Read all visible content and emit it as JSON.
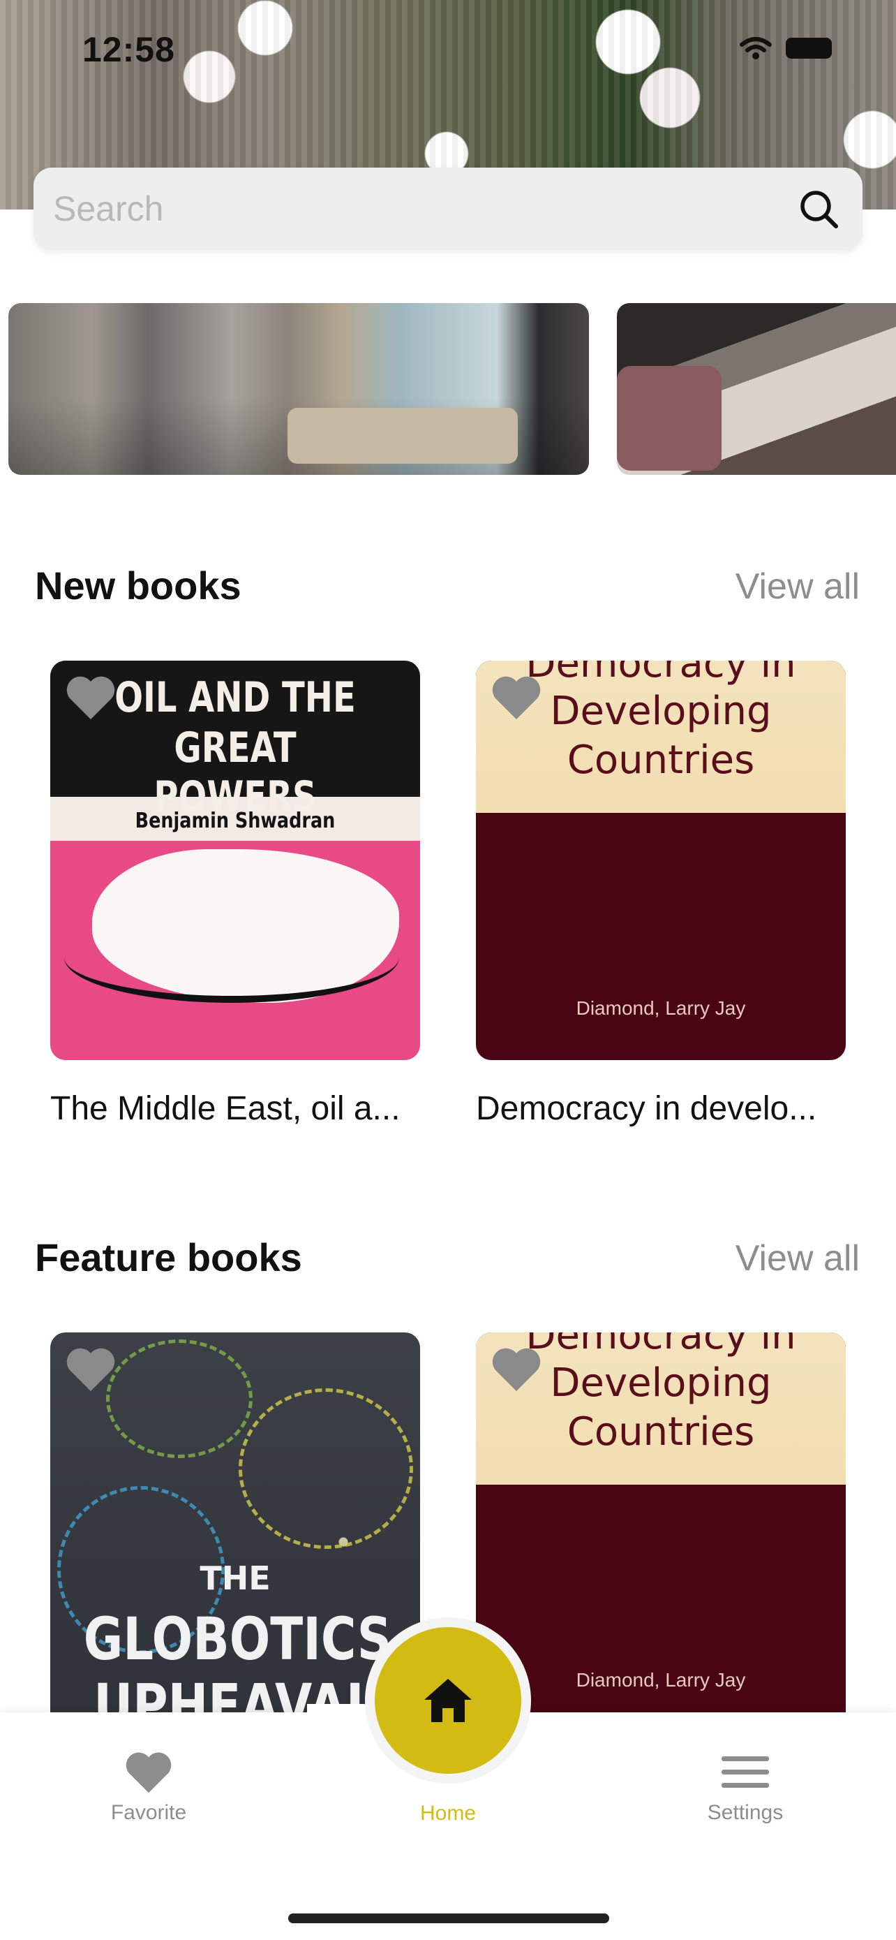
{
  "status_bar": {
    "time": "12:58"
  },
  "search": {
    "placeholder": "Search",
    "value": ""
  },
  "sections": {
    "new_books": {
      "title": "New books",
      "view_all": "View all",
      "books": [
        {
          "caption": "The Middle East, oil a...",
          "cover_title_line1": "OIL AND THE",
          "cover_title_line2": "GREAT POWERS",
          "cover_author": "Benjamin Shwadran"
        },
        {
          "caption": "Democracy in develo...",
          "cover_title_line1": "Democracy in",
          "cover_title_line2": "Developing",
          "cover_title_line3": "Countries",
          "cover_author": "Diamond, Larry Jay"
        }
      ]
    },
    "feature_books": {
      "title": "Feature books",
      "view_all": "View all",
      "books": [
        {
          "cover_title_line1": "THE",
          "cover_title_line2": "GLOBOTICS",
          "cover_title_line3": "UPHEAVAL"
        },
        {
          "cover_title_line1": "Democracy in",
          "cover_title_line2": "Developing",
          "cover_title_line3": "Countries",
          "cover_author": "Diamond, Larry Jay"
        }
      ]
    }
  },
  "tabbar": {
    "favorite_label": "Favorite",
    "home_label": "Home",
    "settings_label": "Settings",
    "active": "Home",
    "accent_color": "#d2bc13",
    "inactive_color": "#8d8d8d"
  }
}
